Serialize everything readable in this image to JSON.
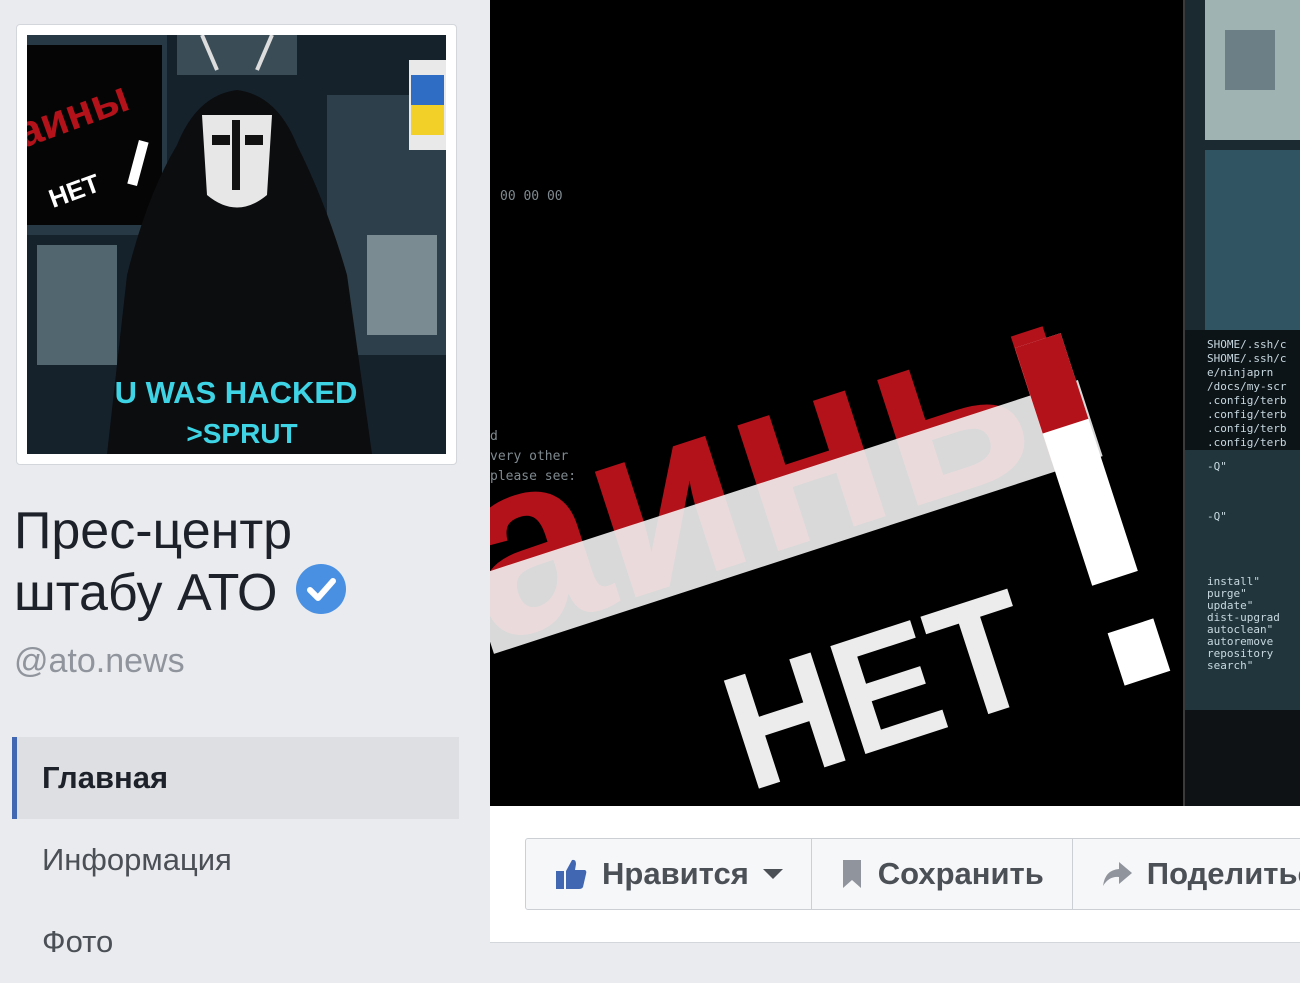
{
  "profile": {
    "name_line1": "Прес-центр",
    "name_line2": "штабу АТО",
    "handle": "@ato.news",
    "verified_icon": "verified-checkmark-icon",
    "picture": {
      "caption_line1": "U WAS HACKED",
      "caption_line2": ">SPRUT",
      "slogan_word1": "аины",
      "slogan_word2": "НЕТ"
    }
  },
  "nav": {
    "items": [
      {
        "label": "Главная",
        "active": true
      },
      {
        "label": "Информация",
        "active": false
      },
      {
        "label": "Фото",
        "active": false
      }
    ]
  },
  "cover": {
    "slogan_word1": "аины",
    "slogan_word2": "НЕТ",
    "terminal_time": "00 00 00",
    "terminal_lines": [
      "d",
      "very other",
      "please see:"
    ],
    "right_terminal_lines": [
      "SHOME/.ssh/c",
      "SHOME/.ssh/c",
      "e/ninjaprn",
      "/docs/my-scr",
      ".config/terb",
      ".config/terb",
      ".config/terb",
      ".config/terb"
    ],
    "right_cmds": [
      "-Q\"",
      "-Q\"",
      "install\"",
      "purge\"",
      "update\"",
      "dist-upgrad",
      "autoclean\"",
      "autoremove",
      "repository",
      "search\""
    ]
  },
  "actions": {
    "like": {
      "label": "Нравится",
      "icon": "thumbs-up-icon"
    },
    "save": {
      "label": "Сохранить",
      "icon": "bookmark-icon"
    },
    "share": {
      "label": "Поделиться",
      "icon": "share-arrow-icon"
    }
  },
  "colors": {
    "background": "#e9ebee",
    "accent": "#4267b2",
    "verified_badge": "#4a90e2",
    "slogan_red": "#b3121a"
  }
}
